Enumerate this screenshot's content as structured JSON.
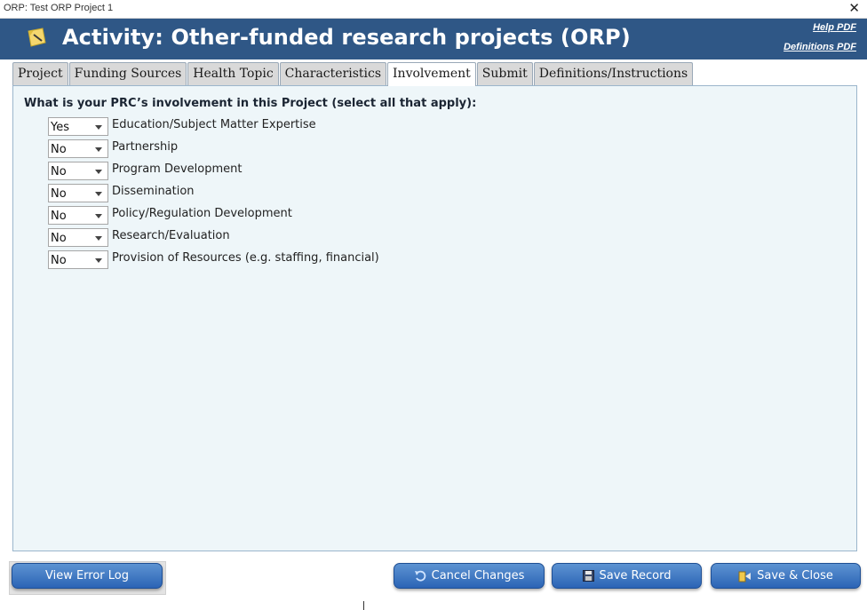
{
  "window": {
    "title": "ORP: Test ORP Project 1",
    "close_glyph": "✕"
  },
  "header": {
    "title": "Activity: Other-funded research projects (ORP)",
    "help_link": "Help PDF",
    "definitions_link": "Definitions PDF",
    "icon": "sticky-note-icon"
  },
  "tabs": [
    {
      "label": "Project"
    },
    {
      "label": "Funding Sources"
    },
    {
      "label": "Health Topic"
    },
    {
      "label": "Characteristics"
    },
    {
      "label": "Involvement",
      "active": true
    },
    {
      "label": "Submit"
    },
    {
      "label": "Definitions/Instructions"
    }
  ],
  "form": {
    "question": "What is your PRC’s involvement in this Project (select all that apply):",
    "rows": [
      {
        "value": "Yes",
        "label": "Education/Subject Matter Expertise"
      },
      {
        "value": "No",
        "label": "Partnership"
      },
      {
        "value": "No",
        "label": "Program Development"
      },
      {
        "value": "No",
        "label": "Dissemination"
      },
      {
        "value": "No",
        "label": "Policy/Regulation Development"
      },
      {
        "value": "No",
        "label": "Research/Evaluation"
      },
      {
        "value": "No",
        "label": "Provision of Resources (e.g. staffing, financial)"
      }
    ]
  },
  "buttons": {
    "view_error_log": "View Error Log",
    "cancel_changes": "Cancel Changes",
    "save_record": "Save Record",
    "save_close": "Save & Close"
  },
  "colors": {
    "header_bg": "#2f5786",
    "panel_bg": "#eef6f9",
    "button_blue": "#2b64b5"
  }
}
